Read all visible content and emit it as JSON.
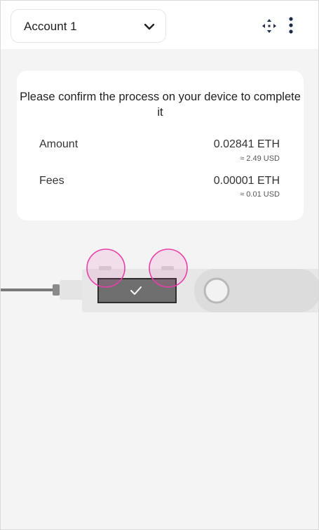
{
  "header": {
    "account_label": "Account 1",
    "chevron_icon": "chevron-down-icon",
    "expand_icon": "expand-arrows-icon",
    "menu_icon": "more-vertical-icon"
  },
  "confirm": {
    "message": "Please confirm the process on your device to complete it",
    "rows": [
      {
        "label": "Amount",
        "value": "0.02841 ETH",
        "fiat": "≈ 2.49 USD"
      },
      {
        "label": "Fees",
        "value": "0.00001 ETH",
        "fiat": "≈ 0.01 USD"
      }
    ]
  },
  "device": {
    "screen_icon": "checkmark-icon",
    "highlight_color": "#e83ea8"
  }
}
